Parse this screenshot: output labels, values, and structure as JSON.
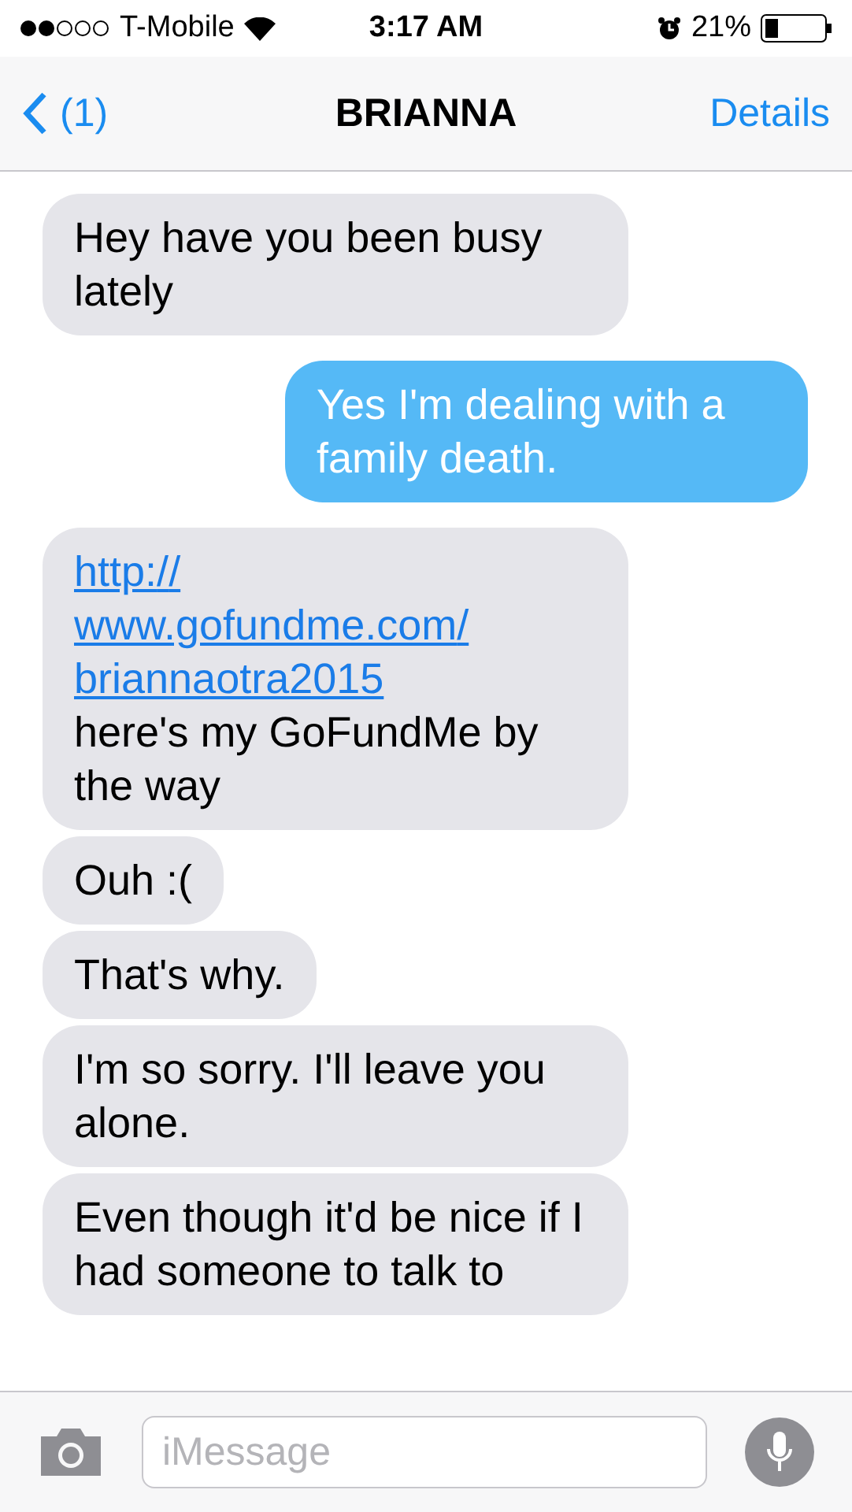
{
  "status_bar": {
    "carrier": "T-Mobile",
    "time": "3:17 AM",
    "battery": "21%"
  },
  "nav": {
    "back": "(1)",
    "title": "BRIANNA",
    "action": "Details"
  },
  "messages": [
    {
      "kind": "in",
      "parts": [
        {
          "kind": "text",
          "text": "Hey have you been busy lately"
        }
      ]
    },
    {
      "kind": "out",
      "parts": [
        {
          "kind": "text",
          "text": "Yes I'm dealing with a family death."
        }
      ]
    },
    {
      "kind": "in",
      "parts": [
        {
          "kind": "link",
          "text": "http://www.gofundme.com/briannaotra2015"
        },
        {
          "kind": "text",
          "text": " here's my GoFundMe by the way"
        }
      ]
    },
    {
      "kind": "in",
      "parts": [
        {
          "kind": "text",
          "text": "Ouh :("
        }
      ]
    },
    {
      "kind": "in",
      "parts": [
        {
          "kind": "text",
          "text": "That's why."
        }
      ]
    },
    {
      "kind": "in",
      "parts": [
        {
          "kind": "text",
          "text": "I'm so sorry. I'll leave you alone."
        }
      ]
    },
    {
      "kind": "in",
      "parts": [
        {
          "kind": "text",
          "text": "Even though it'd be nice if I had someone to talk to"
        }
      ]
    }
  ],
  "composer": {
    "placeholder": "iMessage"
  }
}
